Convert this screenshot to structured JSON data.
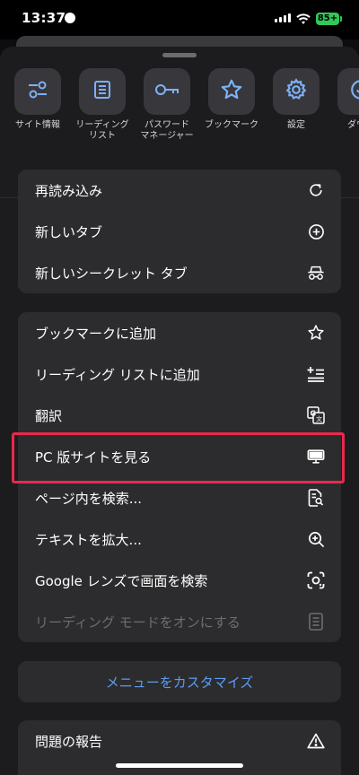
{
  "status": {
    "time": "13:37",
    "battery": "85+"
  },
  "quick_actions": [
    {
      "label": "サイト情報",
      "icon": "site-info-icon"
    },
    {
      "label": "リーディング\nリスト",
      "icon": "reading-list-icon"
    },
    {
      "label": "パスワード\nマネージャー",
      "icon": "password-key-icon"
    },
    {
      "label": "ブックマーク",
      "icon": "star-icon"
    },
    {
      "label": "設定",
      "icon": "gear-icon"
    },
    {
      "label": "ダウン",
      "icon": "download-icon"
    }
  ],
  "group1": [
    {
      "label": "再読み込み",
      "icon": "reload-icon"
    },
    {
      "label": "新しいタブ",
      "icon": "plus-circle-icon"
    },
    {
      "label": "新しいシークレット タブ",
      "icon": "incognito-icon"
    }
  ],
  "group2": [
    {
      "label": "ブックマークに追加",
      "icon": "star-outline-icon"
    },
    {
      "label": "リーディング リストに追加",
      "icon": "add-reading-list-icon"
    },
    {
      "label": "翻訳",
      "icon": "translate-icon"
    },
    {
      "label": "PC 版サイトを見る",
      "icon": "desktop-icon"
    },
    {
      "label": "ページ内を検索...",
      "icon": "find-in-page-icon"
    },
    {
      "label": "テキストを拡大...",
      "icon": "zoom-in-icon"
    },
    {
      "label": "Google レンズで画面を検索",
      "icon": "lens-icon"
    },
    {
      "label": "リーディング モードをオンにする",
      "icon": "reading-mode-icon",
      "disabled": true
    }
  ],
  "customize_label": "メニューをカスタマイズ",
  "group3": [
    {
      "label": "問題の報告",
      "icon": "warning-icon"
    }
  ],
  "colors": {
    "accent": "#5b9cf4",
    "highlight": "#e8294c",
    "card": "#2c2c2e",
    "sheet": "#1c1c1e"
  }
}
